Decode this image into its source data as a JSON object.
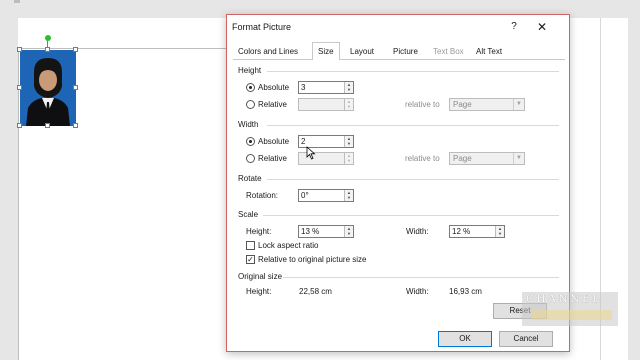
{
  "dialog": {
    "title": "Format Picture",
    "help_label": "?",
    "close_label": "✕",
    "tabs": [
      {
        "label": "Colors and Lines",
        "state": "normal"
      },
      {
        "label": "Size",
        "state": "active"
      },
      {
        "label": "Layout",
        "state": "normal"
      },
      {
        "label": "Picture",
        "state": "normal"
      },
      {
        "label": "Text Box",
        "state": "disabled"
      },
      {
        "label": "Alt Text",
        "state": "normal"
      }
    ],
    "height": {
      "section": "Height",
      "absolute_label": "Absolute",
      "absolute_value": "3",
      "relative_label": "Relative",
      "relative_value": "",
      "relative_to_label": "relative to",
      "relative_to_value": "Page"
    },
    "width": {
      "section": "Width",
      "absolute_label": "Absolute",
      "absolute_value": "2",
      "relative_label": "Relative",
      "relative_value": "",
      "relative_to_label": "relative to",
      "relative_to_value": "Page"
    },
    "rotate": {
      "section": "Rotate",
      "rotation_label": "Rotation:",
      "rotation_value": "0°"
    },
    "scale": {
      "section": "Scale",
      "height_label": "Height:",
      "height_value": "13 %",
      "width_label": "Width:",
      "width_value": "12 %",
      "lock_aspect_label": "Lock aspect ratio",
      "lock_aspect_checked": false,
      "relative_original_label": "Relative to original picture size",
      "relative_original_checked": true
    },
    "original_size": {
      "section": "Original size",
      "height_label": "Height:",
      "height_value": "22,58 cm",
      "width_label": "Width:",
      "width_value": "16,93 cm"
    },
    "reset_label": "Reset",
    "ok_label": "OK",
    "cancel_label": "Cancel"
  },
  "watermark": {
    "text": "CHANNEL"
  },
  "icons": {
    "check": "✓",
    "spin_up": "▲",
    "spin_down": "▼",
    "caret": "▼"
  }
}
